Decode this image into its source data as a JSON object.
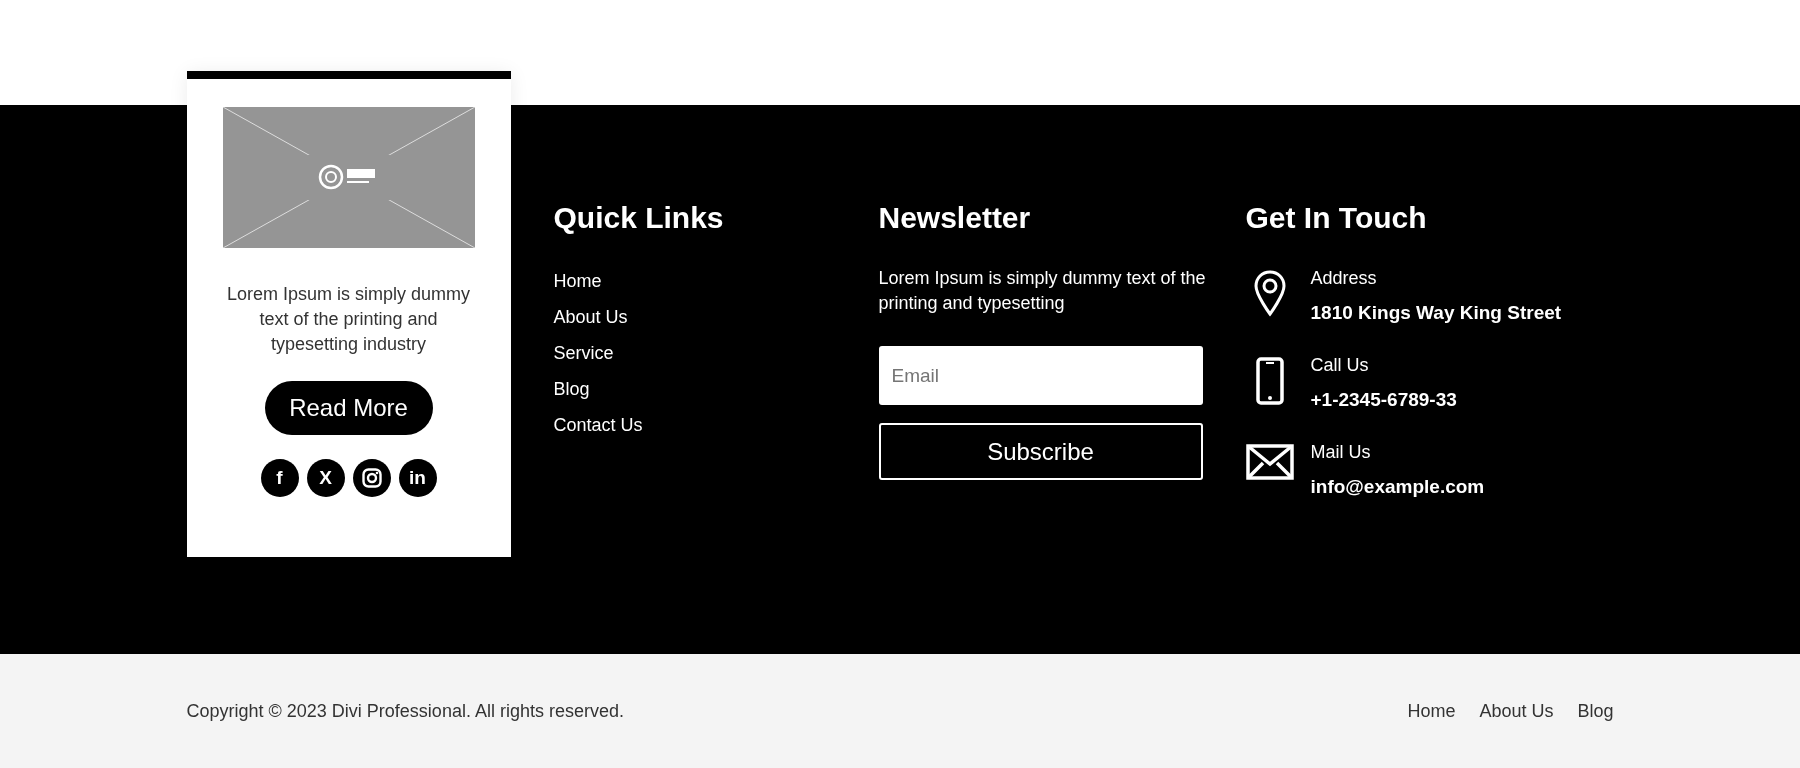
{
  "card": {
    "text": "Lorem Ipsum is simply dummy text of the printing and typesetting industry",
    "button": "Read More",
    "socials": [
      {
        "kind": "glyph",
        "glyph": "f"
      },
      {
        "kind": "glyph",
        "glyph": "X"
      },
      {
        "kind": "camera"
      },
      {
        "kind": "glyph",
        "glyph": "in"
      }
    ]
  },
  "quick_links": {
    "title": "Quick Links",
    "items": [
      "Home",
      "About Us",
      "Service",
      "Blog",
      "Contact Us"
    ]
  },
  "newsletter": {
    "title": "Newsletter",
    "text": "Lorem Ipsum is simply dummy text of the printing and typesetting",
    "email": {
      "placeholder": "Email"
    },
    "button": "Subscribe"
  },
  "contact": {
    "title": "Get In Touch",
    "items": [
      {
        "kind": "address",
        "label": "Address",
        "value": "1810 Kings Way King Street"
      },
      {
        "kind": "phone",
        "label": "Call Us",
        "value": "+1-2345-6789-33"
      },
      {
        "kind": "mail",
        "label": "Mail Us",
        "value": "info@example.com"
      }
    ]
  },
  "bottom_bar": {
    "copyright": "Copyright © 2023 Divi Professional. All rights reserved.",
    "links": [
      "Home",
      "About Us",
      "Blog"
    ]
  }
}
